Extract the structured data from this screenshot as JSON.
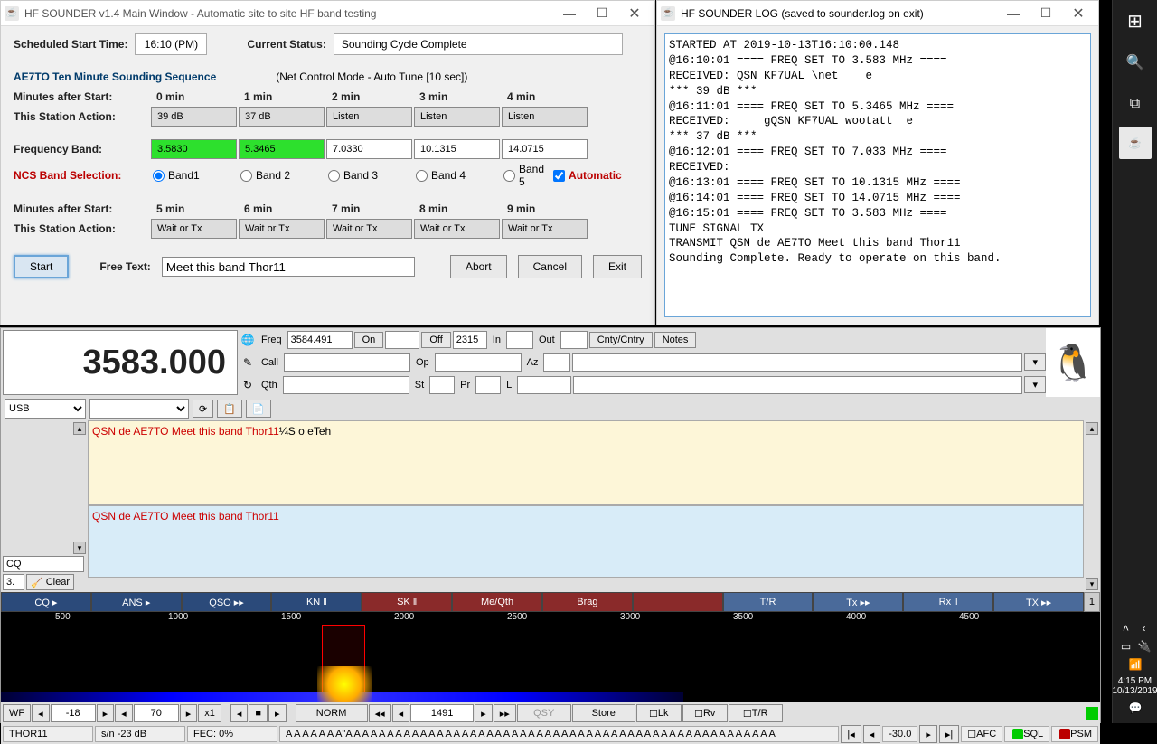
{
  "main_window": {
    "title": "HF SOUNDER v1.4 Main Window - Automatic site to site HF band testing",
    "scheduled_label": "Scheduled Start Time:",
    "scheduled_value": "16:10 (PM)",
    "status_label": "Current Status:",
    "status_value": "Sounding Cycle Complete",
    "seq_title": "AE7TO  Ten Minute Sounding Sequence",
    "mode_title": "(Net Control Mode - Auto Tune [10 sec])",
    "row_min_after": "Minutes after Start:",
    "row_action": "This Station Action:",
    "row_freq": "Frequency Band:",
    "row_ncs": "NCS Band Selection:",
    "auto_label": "Automatic",
    "cols1": [
      {
        "min": "0 min",
        "action": "39 dB",
        "action_style": "gray",
        "freq": "3.5830",
        "freq_style": "green",
        "band": "Band1",
        "checked": true
      },
      {
        "min": "1 min",
        "action": "37 dB",
        "action_style": "gray",
        "freq": "5.3465",
        "freq_style": "green",
        "band": "Band 2",
        "checked": false
      },
      {
        "min": "2 min",
        "action": "Listen",
        "action_style": "gray",
        "freq": "7.0330",
        "freq_style": "white",
        "band": "Band 3",
        "checked": false
      },
      {
        "min": "3 min",
        "action": "Listen",
        "action_style": "gray",
        "freq": "10.1315",
        "freq_style": "white",
        "band": "Band 4",
        "checked": false
      },
      {
        "min": "4 min",
        "action": "Listen",
        "action_style": "gray",
        "freq": "14.0715",
        "freq_style": "white",
        "band": "Band 5",
        "checked": false
      }
    ],
    "cols2": [
      {
        "min": "5 min",
        "action": "Wait or Tx"
      },
      {
        "min": "6 min",
        "action": "Wait or Tx"
      },
      {
        "min": "7 min",
        "action": "Wait or Tx"
      },
      {
        "min": "8 min",
        "action": "Wait or Tx"
      },
      {
        "min": "9 min",
        "action": "Wait or Tx"
      }
    ],
    "start_btn": "Start",
    "freetext_label": "Free Text:",
    "freetext_value": "Meet this band Thor11",
    "abort_btn": "Abort",
    "cancel_btn": "Cancel",
    "exit_btn": "Exit"
  },
  "log_window": {
    "title": "HF SOUNDER LOG (saved to sounder.log on exit)",
    "content": "STARTED AT 2019-10-13T16:10:00.148\n@16:10:01 ==== FREQ SET TO 3.583 MHz ====\nRECEIVED: QSN KF7UAL \\net    e\n*** 39 dB ***\n@16:11:01 ==== FREQ SET TO 5.3465 MHz ====\nRECEIVED:     gQSN KF7UAL wootatt  e\n*** 37 dB ***\n@16:12:01 ==== FREQ SET TO 7.033 MHz ====\nRECEIVED:\n@16:13:01 ==== FREQ SET TO 10.1315 MHz ====\n@16:14:01 ==== FREQ SET TO 14.0715 MHz ====\n@16:15:01 ==== FREQ SET TO 3.583 MHz ====\nTUNE SIGNAL TX\nTRANSMIT QSN de AE7TO Meet this band Thor11\nSounding Complete. Ready to operate on this band."
  },
  "fldigi": {
    "freq_display": "3583.000",
    "mode": "USB",
    "freq_label": "Freq",
    "freq_val": "3584.491",
    "on_label": "On",
    "off_label": "Off",
    "off_val": "2315",
    "in_label": "In",
    "out_label": "Out",
    "cnty_label": "Cnty/Cntry",
    "notes_label": "Notes",
    "call_label": "Call",
    "op_label": "Op",
    "az_label": "Az",
    "qth_label": "Qth",
    "st_label": "St",
    "pr_label": "Pr",
    "l_label": "L",
    "rx_red": "QSN de AE7TO Meet this band Thor11",
    "rx_tail": "¼S o eTeh",
    "tx_red": "QSN de AE7TO Meet this band Thor11",
    "cq_field": "CQ",
    "clear_btn": "Clear",
    "val_3": "3.",
    "macros": [
      {
        "label": "CQ ▸",
        "style": "blue"
      },
      {
        "label": "ANS ▸",
        "style": "blue"
      },
      {
        "label": "QSO ▸▸",
        "style": "blue"
      },
      {
        "label": "KN ‖",
        "style": "blue"
      },
      {
        "label": "SK ‖",
        "style": "red"
      },
      {
        "label": "Me/Qth",
        "style": "red"
      },
      {
        "label": "Brag",
        "style": "red"
      },
      {
        "label": "",
        "style": "red"
      },
      {
        "label": "T/R",
        "style": "grayblue"
      },
      {
        "label": "Tx ▸▸",
        "style": "grayblue"
      },
      {
        "label": "Rx ‖",
        "style": "grayblue"
      },
      {
        "label": "TX ▸▸",
        "style": "grayblue"
      }
    ],
    "macro_num": "1",
    "wf_ticks": [
      "500",
      "1000",
      "1500",
      "2000",
      "2500",
      "3000",
      "3500",
      "4000",
      "4500"
    ],
    "wf_controls": {
      "wf": "WF",
      "v1": "-18",
      "v2": "70",
      "zoom": "x1",
      "norm": "NORM",
      "cursor": "1491",
      "qsy": "QSY",
      "store": "Store",
      "lk": "Lk",
      "rv": "Rv",
      "tr": "T/R"
    },
    "status": {
      "mode": "THOR11",
      "sn": "s/n -23 dB",
      "fec": "FEC:    0%",
      "chars": "A A A A A A A\"A A A A A A A A A A A A A A A A A A A A A A A A A A A A A A A A A A A A A A A A A A A A A A A A A A A A",
      "db": "-30.0",
      "afc": "AFC",
      "sql": "SQL",
      "psm": "PSM"
    }
  },
  "tray": {
    "time": "4:15 PM",
    "date": "10/13/2019"
  }
}
